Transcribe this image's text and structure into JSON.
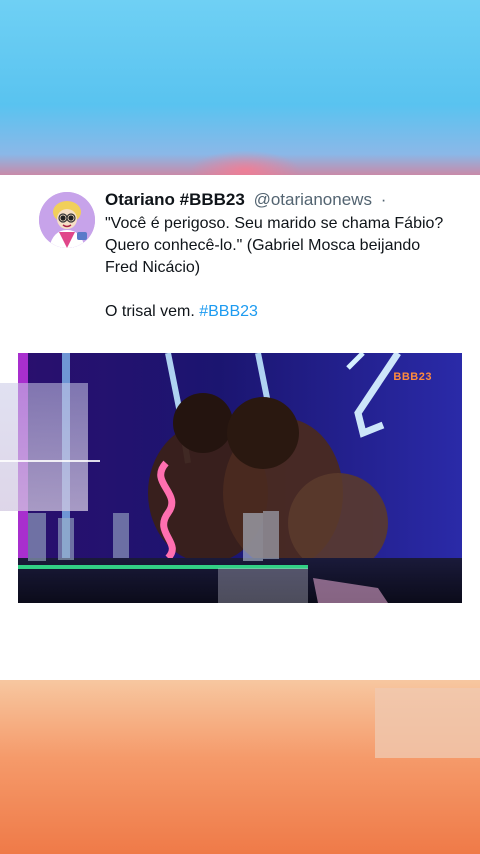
{
  "tweet": {
    "display_name": "Otariano #BBB23",
    "handle": "@otarianonews",
    "separator": "·",
    "quote": "\"Você é perigoso. Seu marido se chama Fábio? Quero conhecê-lo.\" (Gabriel Mosca beijando Fred Nicácio)",
    "line2_prefix": "O trisal vem. ",
    "hashtag": "#BBB23"
  },
  "media": {
    "watermark": "BBB23"
  },
  "colors": {
    "hashtag": "#1d9bf0",
    "bg_top": "#59c3f0",
    "bg_bottom": "#ef7a48"
  }
}
